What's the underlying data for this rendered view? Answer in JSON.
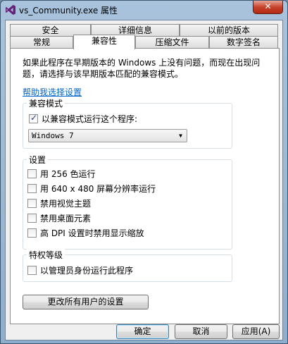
{
  "window": {
    "title": "vs_Community.exe 属性",
    "close_label": "✕"
  },
  "tabs": {
    "row1": [
      "安全",
      "详细信息",
      "以前的版本"
    ],
    "row2": [
      "常规",
      "兼容性",
      "压缩文件",
      "数字签名"
    ]
  },
  "description": "如果此程序在早期版本的 Windows 上没有问题，而现在出现问题，请选择与该早期版本匹配的兼容模式。",
  "help_link": "帮助我选择设置",
  "compat_mode": {
    "label": "兼容模式",
    "run_checkbox": "以兼容模式运行这个程序:",
    "selected_os": "Windows 7"
  },
  "settings": {
    "label": "设置",
    "items": [
      "用 256 色运行",
      "用 640 x 480 屏幕分辨率运行",
      "禁用视觉主题",
      "禁用桌面元素",
      "高 DPI 设置时禁用显示缩放"
    ]
  },
  "privilege": {
    "label": "特权等级",
    "admin_checkbox": "以管理员身份运行此程序"
  },
  "change_all_users_button": "更改所有用户的设置",
  "buttons": {
    "ok": "确定",
    "cancel": "取消",
    "apply": "应用(A)"
  }
}
